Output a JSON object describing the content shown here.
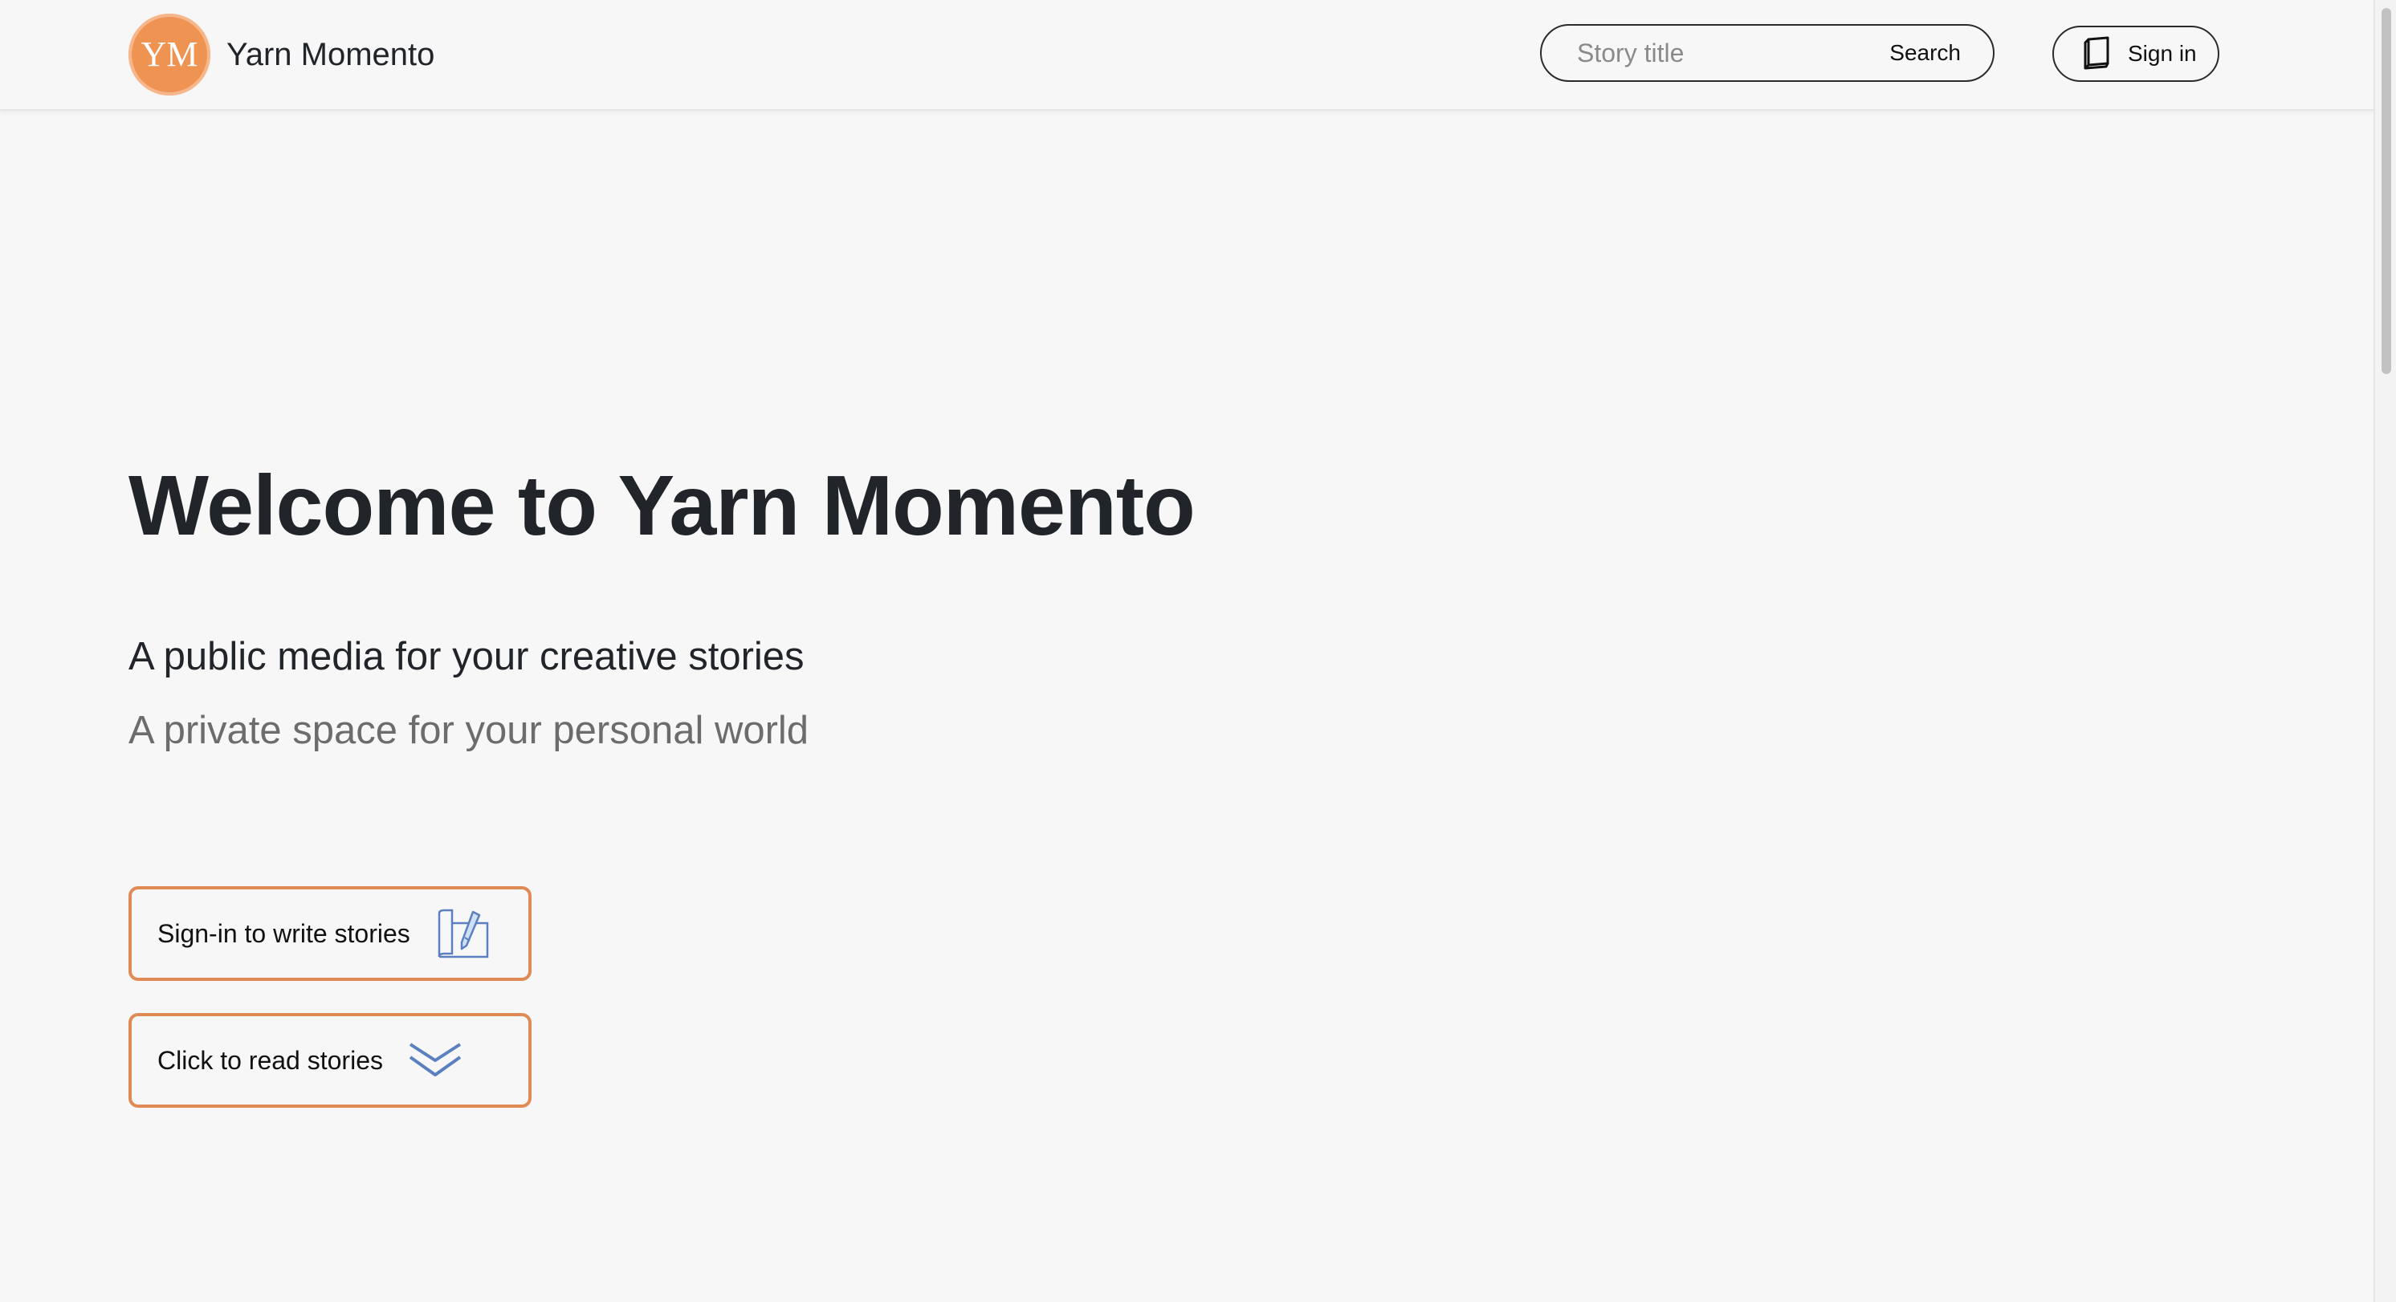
{
  "header": {
    "brand_name": "Yarn Momento",
    "logo_text": "YM",
    "logo_color": "#ef9353",
    "search": {
      "placeholder": "Story title",
      "value": "",
      "button_label": "Search"
    },
    "signin_label": "Sign in"
  },
  "hero": {
    "title": "Welcome to Yarn Momento",
    "subtitle_primary": "A public media for your creative stories",
    "subtitle_secondary": "A private space for your personal world"
  },
  "actions": [
    {
      "label": "Sign-in to write stories",
      "icon": "write-scroll-icon"
    },
    {
      "label": "Click to read stories",
      "icon": "double-chevron-down-icon"
    }
  ],
  "colors": {
    "accent": "#e08a55",
    "icon_blue": "#5b7fbf"
  }
}
